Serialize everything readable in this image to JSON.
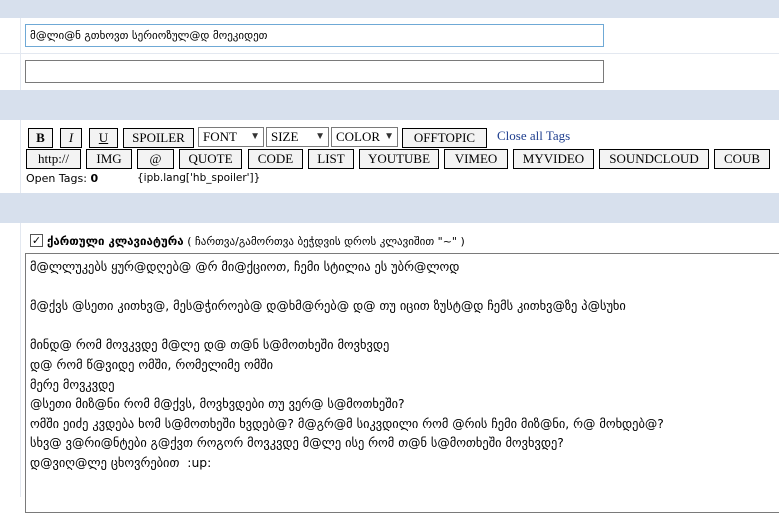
{
  "form": {
    "title_value": "მ@ლი@ნ გთხოვთ სერიოზულ@დ მოეკიდეთ",
    "description_value": ""
  },
  "toolbar": {
    "row1": [
      {
        "label": "B",
        "type": "button",
        "style": "bold"
      },
      {
        "label": "I",
        "type": "button",
        "style": "italic"
      },
      {
        "label": "U",
        "type": "button",
        "style": "underline"
      },
      {
        "label": "SPOILER",
        "type": "button"
      },
      {
        "label": "FONT",
        "type": "select"
      },
      {
        "label": "SIZE",
        "type": "select"
      },
      {
        "label": "COLOR",
        "type": "select"
      },
      {
        "label": "OFFTOPIC",
        "type": "button"
      }
    ],
    "close_all_label": "Close all Tags",
    "row2": [
      "http://",
      "IMG",
      "@",
      "QUOTE",
      "CODE",
      "LIST",
      "YOUTUBE",
      "VIMEO",
      "MYVIDEO",
      "SOUNDCLOUD",
      "COUB"
    ],
    "open_tags_label": "Open Tags:",
    "open_tags_count": "0",
    "open_tags_placeholder": "{ipb.lang['hb_spoiler']}"
  },
  "keyboard": {
    "checked": true,
    "label": "ქართული კლავიატურა",
    "hint": "( ჩართვა/გამორთვა ბეჭდვის დროს კლავიშით \"~\" )"
  },
  "editor": {
    "lines": [
      "მ@ლლუკებს ყურ@დღებ@ @რ მი@ქციოთ, ჩემი სტილია ეს უბრ@ლოდ",
      "",
      "მ@ქვს @სეთი კითხვ@, მეს@ჭიროებ@ დ@ხმ@რებ@ დ@ თუ იცით ზუსტ@დ ჩემს კითხვ@ზე პ@სუხი",
      "",
      "მინდ@ რომ მოვკვდე მ@ლე დ@ თ@ნ ს@მოთხეში მოვხვდე",
      "დ@ რომ წ@ვიდე ომში, რომელიმე ომში",
      "მერე მოვკვდე",
      "@სეთი მიზ@ნი რომ მ@ქვს, მოვხვდები თუ ვერ@ ს@მოთხეში?",
      "ომში ეიძე კვდება ხომ ს@მოთხეში ხვდებ@? მ@გრ@მ სიკვდილი რომ @რის ჩემი მიზ@ნი, რ@ მოხდებ@?",
      "სხვ@ ვ@რი@ნტები გ@ქვთ როგორ მოვკვდე მ@ლე ისე რომ თ@ნ ს@მოთხეში მოვხვდე?",
      "დ@ვიღ@ლე ცხოვრებით  :up:"
    ]
  }
}
